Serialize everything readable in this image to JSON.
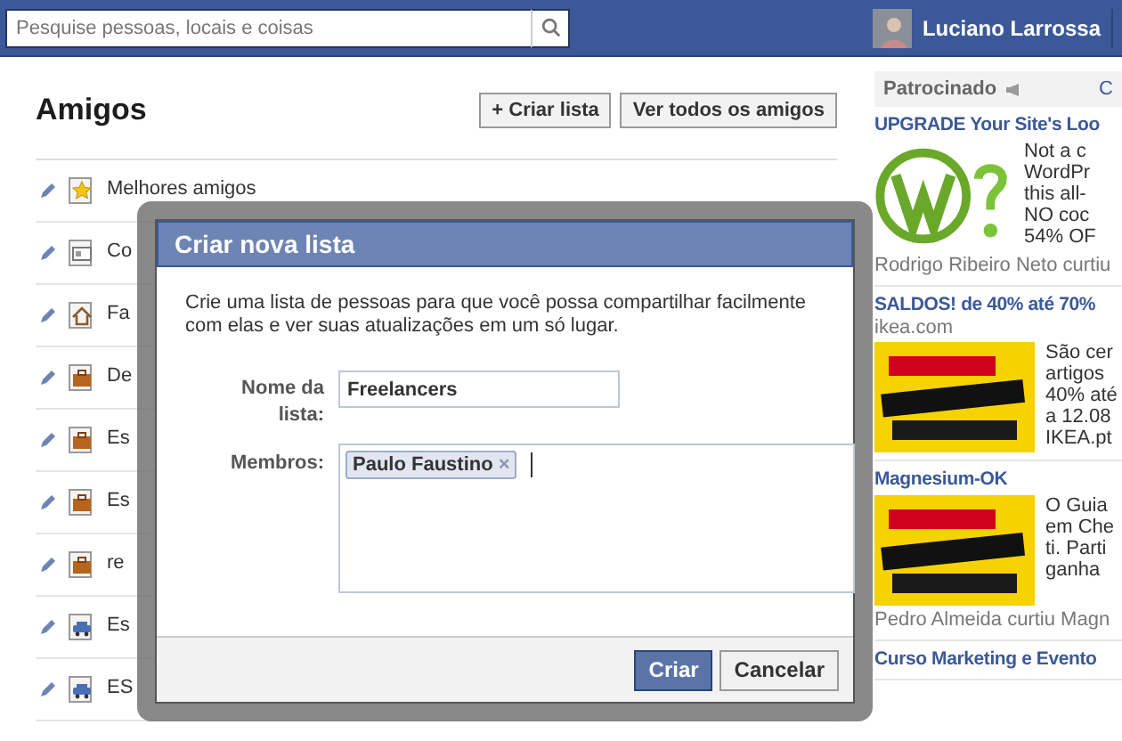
{
  "top_bar": {
    "search": {
      "placeholder": "Pesquise pessoas, locais e coisas"
    },
    "user": {
      "name": "Luciano Larrossa"
    }
  },
  "friends": {
    "title": "Amigos",
    "buttons": [
      {
        "label": "Criar lista",
        "icon": "+"
      },
      {
        "label": "Ver todos os amigos"
      }
    ],
    "lists": [
      {
        "kind": "star",
        "label": "Melhores amigos"
      },
      {
        "kind": "card",
        "label": "Co"
      },
      {
        "kind": "house",
        "label": "Fa"
      },
      {
        "kind": "briefcase",
        "label": "De"
      },
      {
        "kind": "briefcase",
        "label": "Es"
      },
      {
        "kind": "briefcase",
        "label": "Es"
      },
      {
        "kind": "briefcase",
        "label": "re"
      },
      {
        "kind": "car",
        "label": "Es"
      },
      {
        "kind": "car",
        "label": "ES"
      }
    ]
  },
  "sidebar": {
    "header": "Patrocinado",
    "link": "C",
    "ads": [
      {
        "title": "UPGRADE Your Site's Loo",
        "kind": "logo",
        "lines": [
          "Not a c",
          "WordPr",
          "this all-",
          "NO coc",
          "54% OF"
        ],
        "social": "Rodrigo Ribeiro Neto curtiu"
      },
      {
        "title": "SALDOS! de 40% até 70%",
        "domain": "ikea.com",
        "kind": "picture",
        "lines": [
          "São cer",
          "artigos",
          "40% até",
          "a 12.08",
          "IKEA.pt"
        ]
      },
      {
        "title": "Magnesium-OK",
        "kind": "picture",
        "lines": [
          "O Guia",
          "em Che",
          "ti. Parti",
          "ganha"
        ],
        "social": "Pedro Almeida curtiu Magn"
      },
      {
        "title": "Curso Marketing e Evento"
      }
    ]
  },
  "dialog": {
    "title": "Criar nova lista",
    "description": "Crie uma lista de pessoas para que você possa compartilhar facilmente com elas e ver suas atualizações em um só lugar.",
    "name_label": "Nome da lista:",
    "name_value": "Freelancers",
    "members_label": "Membros:",
    "members": [
      {
        "name": "Paulo Faustino",
        "remove": "×"
      }
    ],
    "buttons": [
      {
        "label": "Criar",
        "primary": true
      },
      {
        "label": "Cancelar",
        "primary": false
      }
    ]
  }
}
